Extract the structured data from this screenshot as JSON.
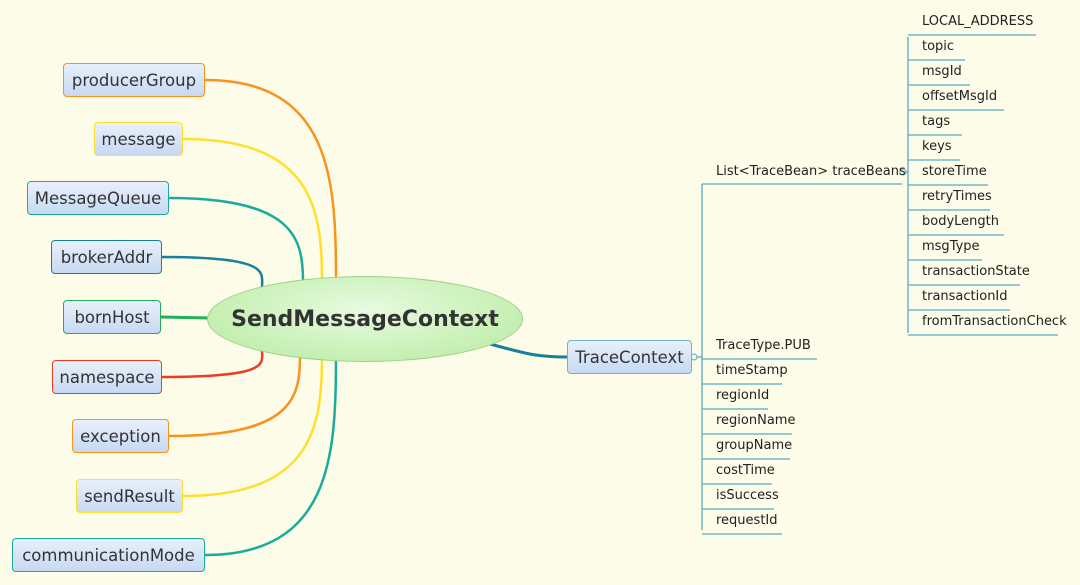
{
  "root": {
    "label": "SendMessageContext"
  },
  "left_nodes": [
    {
      "label": "producerGroup",
      "color": "#f7941d"
    },
    {
      "label": "message",
      "color": "#ffdf2e"
    },
    {
      "label": "MessageQueue",
      "color": "#1aab9b"
    },
    {
      "label": "brokerAddr",
      "color": "#187f9c"
    },
    {
      "label": "bornHost",
      "color": "#1fb05a"
    },
    {
      "label": "namespace",
      "color": "#ef3b24"
    },
    {
      "label": "exception",
      "color": "#f7941d"
    },
    {
      "label": "sendResult",
      "color": "#ffdf2e"
    },
    {
      "label": "communicationMode",
      "color": "#1aab9b"
    }
  ],
  "trace_context": {
    "label": "TraceContext",
    "color": "#187f9c",
    "trace_beans": {
      "label": "List<TraceBean> traceBeans",
      "fields": [
        "LOCAL_ADDRESS",
        "topic",
        "msgId",
        "offsetMsgId",
        "tags",
        "keys",
        "storeTime",
        "retryTimes",
        "bodyLength",
        "msgType",
        "transactionState",
        "transactionId",
        "fromTransactionCheck"
      ]
    },
    "fields": [
      "TraceType.PUB",
      "timeStamp",
      "regionId",
      "regionName",
      "groupName",
      "costTime",
      "isSuccess",
      "requestId"
    ]
  }
}
